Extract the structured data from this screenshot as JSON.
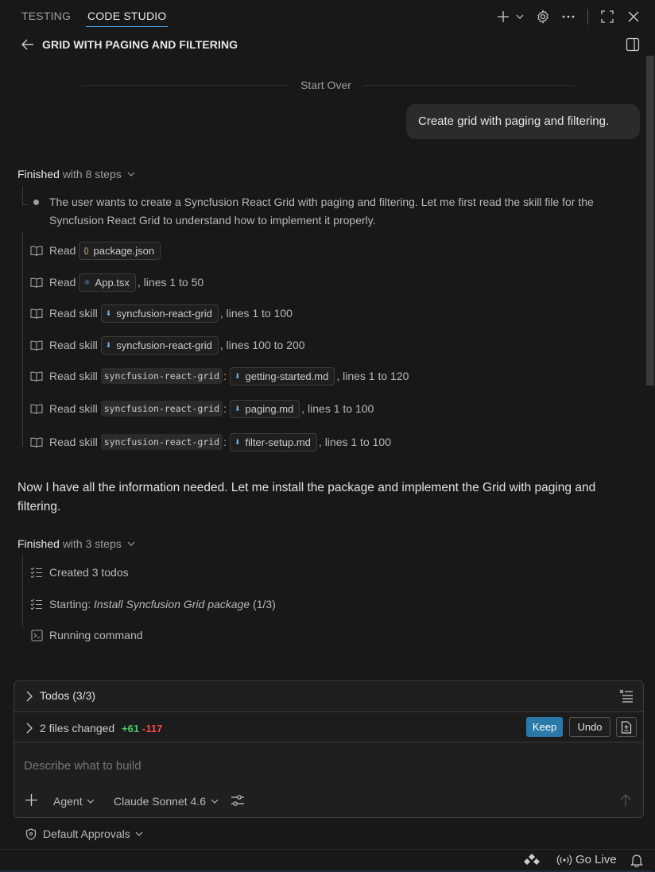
{
  "tabs": [
    {
      "label": "TESTING"
    },
    {
      "label": "CODE STUDIO"
    }
  ],
  "header": {
    "title": "GRID WITH PAGING AND FILTERING"
  },
  "start_over": "Start Over",
  "user_message": "Create grid with paging and filtering.",
  "group1": {
    "finished": "Finished",
    "steps_label": "with 8 steps",
    "thought": "The user wants to create a Syncfusion React Grid with paging and filtering. Let me first read the skill file for the Syncfusion React Grid to understand how to implement it properly.",
    "steps": [
      {
        "verb": "Read",
        "chip": "package.json",
        "chip_icon": "{}",
        "suffix": ""
      },
      {
        "verb": "Read",
        "chip": "App.tsx",
        "chip_icon": "⚛",
        "suffix": ", lines 1 to 50"
      },
      {
        "verb": "Read skill",
        "chip": "syncfusion-react-grid",
        "chip_icon": "⬇",
        "suffix": ", lines 1 to 100"
      },
      {
        "verb": "Read skill",
        "chip": "syncfusion-react-grid",
        "chip_icon": "⬇",
        "suffix": ", lines 100 to 200"
      },
      {
        "verb": "Read skill",
        "code": "syncfusion-react-grid",
        "colon": ":",
        "chip": "getting-started.md",
        "chip_icon": "⬇",
        "suffix": ", lines 1 to 120"
      },
      {
        "verb": "Read skill",
        "code": "syncfusion-react-grid",
        "colon": ":",
        "chip": "paging.md",
        "chip_icon": "⬇",
        "suffix": ", lines 1 to 100"
      },
      {
        "verb": "Read skill",
        "code": "syncfusion-react-grid",
        "colon": ":",
        "chip": "filter-setup.md",
        "chip_icon": "⬇",
        "suffix": ", lines 1 to 100"
      }
    ]
  },
  "assistant_message": "Now I have all the information needed. Let me install the package and implement the Grid with paging and filtering.",
  "group2": {
    "finished": "Finished",
    "steps_label": "with 3 steps",
    "steps": [
      {
        "text": "Created 3 todos"
      },
      {
        "prefix": "Starting: ",
        "italic": "Install Syncfusion Grid package",
        "suffix": " (1/3)"
      },
      {
        "text": "Running command"
      }
    ]
  },
  "panel": {
    "todos_label": "Todos (3/3)",
    "files_changed": "2 files changed",
    "added": "+61",
    "removed": "-117",
    "keep_label": "Keep",
    "undo_label": "Undo",
    "input_placeholder": "Describe what to build",
    "mode": "Agent",
    "model": "Claude Sonnet 4.6"
  },
  "approvals": "Default Approvals",
  "status_bar": {
    "go_live": "Go Live"
  },
  "colors": {
    "accent": "#4daafc",
    "keep_bg": "#2b79a8",
    "added": "#4ec969",
    "removed": "#f14c4c",
    "background": "#181818"
  },
  "icons": [
    "arrow-left-icon",
    "plus-icon",
    "chevron-down-icon",
    "gear-icon",
    "ellipsis-icon",
    "maximize-icon",
    "close-icon",
    "split-panel-icon",
    "book-icon",
    "checklist-icon",
    "terminal-icon",
    "chevron-right-icon",
    "clear-list-icon",
    "file-diff-icon",
    "sliders-icon",
    "send-arrow-icon",
    "shield-icon",
    "copilot-icon",
    "broadcast-icon",
    "bell-icon"
  ]
}
